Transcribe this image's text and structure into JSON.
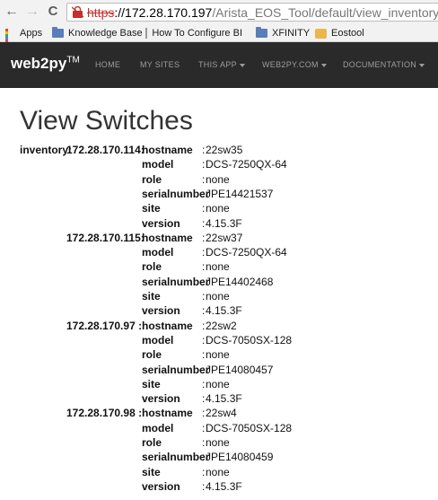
{
  "browser": {
    "url_protocol": "https",
    "url_host": "://172.28.170.197",
    "url_path": "/Arista_EOS_Tool/default/view_inventory",
    "back_icon": "←",
    "forward_icon": "→",
    "reload_icon": "C"
  },
  "bookmarks": [
    {
      "label": "Apps",
      "icon": "apps-grid-icon"
    },
    {
      "label": "Knowledge Base",
      "icon": "folder-icon"
    },
    {
      "label": "How To Configure BI",
      "icon": "page-icon"
    },
    {
      "label": "XFINITY",
      "icon": "folder-icon"
    },
    {
      "label": "Eostool",
      "icon": "tool-icon"
    }
  ],
  "navbar": {
    "brand": "web2py",
    "brand_tm": "TM",
    "items": [
      {
        "label": "HOME"
      },
      {
        "label": "MY SITES"
      },
      {
        "label": "THIS APP"
      },
      {
        "label": "WEB2PY.COM"
      },
      {
        "label": "DOCUMENTATION"
      }
    ]
  },
  "page": {
    "title": "View Switches",
    "inventory_label": "inventory:",
    "switches": [
      {
        "ip": "172.28.170.114:",
        "fields": [
          {
            "key": "hostname",
            "value": "22sw35"
          },
          {
            "key": "model",
            "value": "DCS-7250QX-64"
          },
          {
            "key": "role",
            "value": "none"
          },
          {
            "key": "serialnumber",
            "value": "JPE14421537"
          },
          {
            "key": "site",
            "value": "none"
          },
          {
            "key": "version",
            "value": "4.15.3F"
          }
        ]
      },
      {
        "ip": "172.28.170.115:",
        "fields": [
          {
            "key": "hostname",
            "value": "22sw37"
          },
          {
            "key": "model",
            "value": "DCS-7250QX-64"
          },
          {
            "key": "role",
            "value": "none"
          },
          {
            "key": "serialnumber",
            "value": "JPE14402468"
          },
          {
            "key": "site",
            "value": "none"
          },
          {
            "key": "version",
            "value": "4.15.3F"
          }
        ]
      },
      {
        "ip": "172.28.170.97 :",
        "fields": [
          {
            "key": "hostname",
            "value": "22sw2"
          },
          {
            "key": "model",
            "value": "DCS-7050SX-128"
          },
          {
            "key": "role",
            "value": "none"
          },
          {
            "key": "serialnumber",
            "value": "JPE14080457"
          },
          {
            "key": "site",
            "value": "none"
          },
          {
            "key": "version",
            "value": "4.15.3F"
          }
        ]
      },
      {
        "ip": "172.28.170.98 :",
        "fields": [
          {
            "key": "hostname",
            "value": "22sw4"
          },
          {
            "key": "model",
            "value": "DCS-7050SX-128"
          },
          {
            "key": "role",
            "value": "none"
          },
          {
            "key": "serialnumber",
            "value": "JPE14080459"
          },
          {
            "key": "site",
            "value": "none"
          },
          {
            "key": "version",
            "value": "4.15.3F"
          }
        ]
      }
    ]
  }
}
